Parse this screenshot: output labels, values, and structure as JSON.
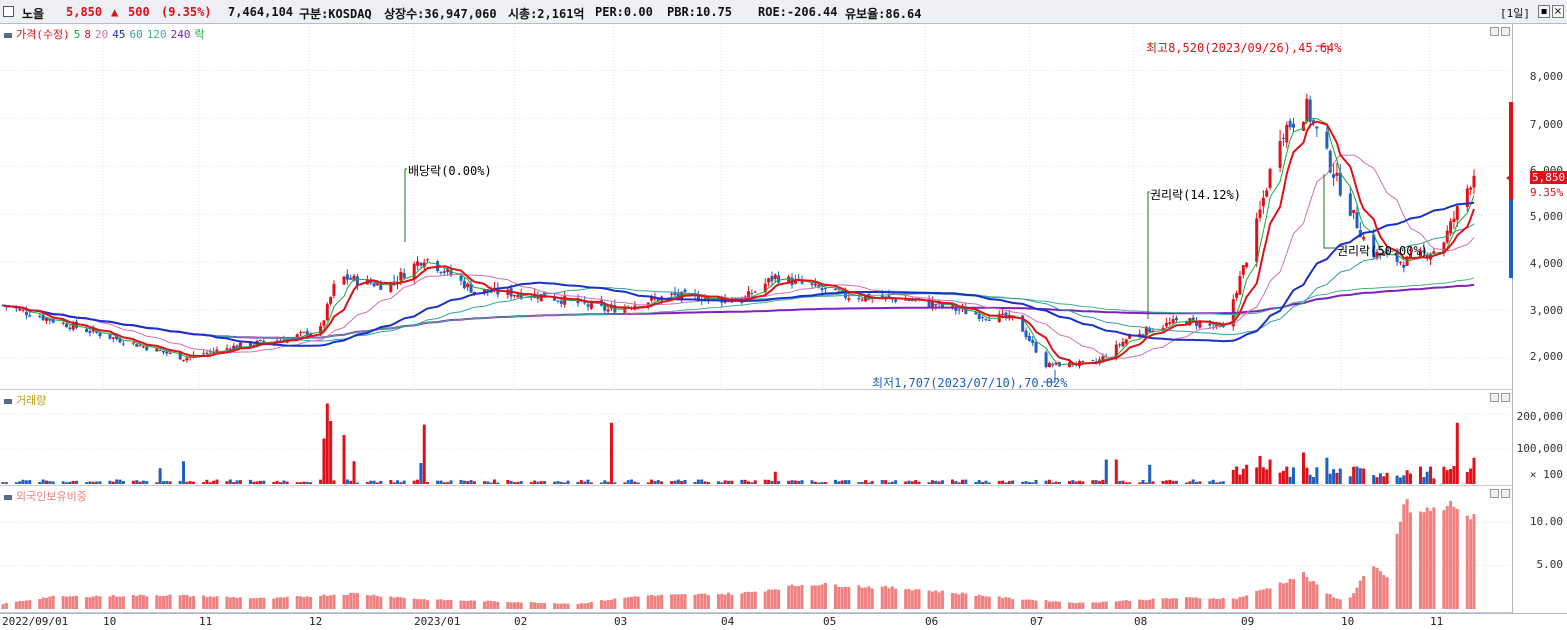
{
  "header": {
    "name": "노을",
    "price": "5,850",
    "change_arrow": "▲",
    "change": "500",
    "change_pct": "(9.35%)",
    "volume": "7,464,104",
    "market": "구분:KOSDAQ",
    "shares": "상장수:36,947,060",
    "mktcap": "시총:2,161억",
    "per": "PER:0.00",
    "pbr": "PBR:10.75",
    "roe": "ROE:-206.44",
    "float": "유보율:86.64",
    "period_btn": "[1일]"
  },
  "price_pane": {
    "legend": {
      "price": "가격(수정)",
      "ma5": "5",
      "ma8": "8",
      "ma20": "20",
      "ma45": "45",
      "ma60": "60",
      "ma120": "120",
      "ma240": "240",
      "ex": "락"
    },
    "annotations": {
      "dividend": "배당락(0.00%)",
      "rights1": "권리락(14.12%)",
      "rights2": "권리락(50.00%)",
      "high": "최고8,520(2023/09/26),45.64%",
      "low": "최저1,707(2023/07/10),70.82%"
    },
    "y_ticks": [
      "8,000",
      "7,000",
      "6,000",
      "5,000",
      "4,000",
      "3,000",
      "2,000"
    ],
    "current_label": "5,850",
    "current_pct": "9.35%"
  },
  "volume_pane": {
    "legend": "거래량",
    "y_ticks": [
      "200,000",
      "100,000",
      "× 100"
    ]
  },
  "foreign_pane": {
    "legend": "외국인보유비중",
    "y_ticks": [
      "10.00",
      "5.00"
    ]
  },
  "x_axis": [
    "2022/09/01",
    "10",
    "11",
    "12",
    "2023/01",
    "02",
    "03",
    "04",
    "05",
    "06",
    "07",
    "08",
    "09",
    "10",
    "11"
  ],
  "colors": {
    "up": "#e0101a",
    "down": "#1f5fbf",
    "ma5": "#1aa83a",
    "ma8": "#e0101a",
    "ma20": "#d070b0",
    "ma45": "#1a30c8",
    "ma60": "#30a0a0",
    "ma120": "#40b090",
    "ma240": "#8020c0",
    "foreign": "#f08080"
  },
  "chart_data": {
    "type": "candlestick",
    "title": "노을",
    "x_range": [
      "2022/09/01",
      "2023/11"
    ],
    "ylim": [
      1500,
      8800
    ],
    "price_anchors": [
      [
        "2022/09/01",
        3100
      ],
      [
        "2022/09/20",
        2700
      ],
      [
        "2022/10/10",
        2300
      ],
      [
        "2022/10/25",
        2000
      ],
      [
        "2022/11/10",
        2250
      ],
      [
        "2022/11/25",
        2400
      ],
      [
        "2022/12/05",
        2600
      ],
      [
        "2022/12/10",
        3700
      ],
      [
        "2022/12/25",
        3500
      ],
      [
        "2023/01/05",
        4100
      ],
      [
        "2023/01/20",
        3400
      ],
      [
        "2023/02/10",
        3300
      ],
      [
        "2023/03/01",
        3000
      ],
      [
        "2023/03/20",
        3300
      ],
      [
        "2023/04/10",
        3200
      ],
      [
        "2023/04/20",
        3700
      ],
      [
        "2023/05/10",
        3300
      ],
      [
        "2023/06/01",
        3200
      ],
      [
        "2023/06/20",
        2900
      ],
      [
        "2023/07/01",
        2800
      ],
      [
        "2023/07/10",
        1850
      ],
      [
        "2023/07/25",
        1900
      ],
      [
        "2023/08/05",
        2500
      ],
      [
        "2023/08/20",
        2800
      ],
      [
        "2023/09/01",
        2600
      ],
      [
        "2023/09/10",
        4500
      ],
      [
        "2023/09/18",
        6700
      ],
      [
        "2023/09/26",
        7200
      ],
      [
        "2023/10/05",
        5700
      ],
      [
        "2023/10/15",
        4200
      ],
      [
        "2023/10/25",
        4000
      ],
      [
        "2023/11/05",
        4300
      ],
      [
        "2023/11/15",
        5850
      ]
    ],
    "high": {
      "date": "2023/09/26",
      "value": 8520
    },
    "low": {
      "date": "2023/07/10",
      "value": 1707
    },
    "volume_ylim": [
      0,
      240000
    ],
    "volume_spikes": [
      [
        "2022/10/18",
        45000
      ],
      [
        "2022/10/25",
        65000
      ],
      [
        "2022/12/06",
        130000
      ],
      [
        "2022/12/07",
        230000
      ],
      [
        "2022/12/08",
        180000
      ],
      [
        "2022/12/12",
        140000
      ],
      [
        "2022/12/15",
        65000
      ],
      [
        "2023/01/04",
        60000
      ],
      [
        "2023/01/05",
        170000
      ],
      [
        "2023/03/02",
        175000
      ],
      [
        "2023/04/20",
        35000
      ],
      [
        "2023/07/28",
        70000
      ],
      [
        "2023/07/31",
        70000
      ],
      [
        "2023/08/10",
        55000
      ],
      [
        "2023/09/08",
        55000
      ],
      [
        "2023/09/12",
        80000
      ],
      [
        "2023/09/15",
        70000
      ],
      [
        "2023/09/25",
        90000
      ],
      [
        "2023/10/02",
        75000
      ],
      [
        "2023/11/10",
        175000
      ],
      [
        "2023/11/12",
        120000
      ],
      [
        "2023/11/15",
        75000
      ]
    ],
    "foreign_ylim": [
      0,
      13
    ],
    "foreign_anchors": [
      [
        "2022/09/01",
        0.6
      ],
      [
        "2022/09/15",
        1.4
      ],
      [
        "2022/10/20",
        1.6
      ],
      [
        "2022/11/20",
        1.2
      ],
      [
        "2022/12/15",
        1.8
      ],
      [
        "2023/01/05",
        1.1
      ],
      [
        "2023/02/20",
        0.6
      ],
      [
        "2023/03/10",
        1.5
      ],
      [
        "2023/04/10",
        1.8
      ],
      [
        "2023/04/30",
        2.9
      ],
      [
        "2023/06/01",
        2.3
      ],
      [
        "2023/06/30",
        1.2
      ],
      [
        "2023/07/20",
        0.7
      ],
      [
        "2023/08/20",
        1.3
      ],
      [
        "2023/09/05",
        1.2
      ],
      [
        "2023/09/15",
        2.5
      ],
      [
        "2023/09/25",
        4.0
      ],
      [
        "2023/10/01",
        2.0
      ],
      [
        "2023/10/08",
        0.7
      ],
      [
        "2023/10/15",
        5.0
      ],
      [
        "2023/10/20",
        3.5
      ],
      [
        "2023/10/25",
        12.0
      ],
      [
        "2023/10/30",
        11.0
      ],
      [
        "2023/11/10",
        12.0
      ],
      [
        "2023/11/15",
        10.2
      ]
    ]
  }
}
